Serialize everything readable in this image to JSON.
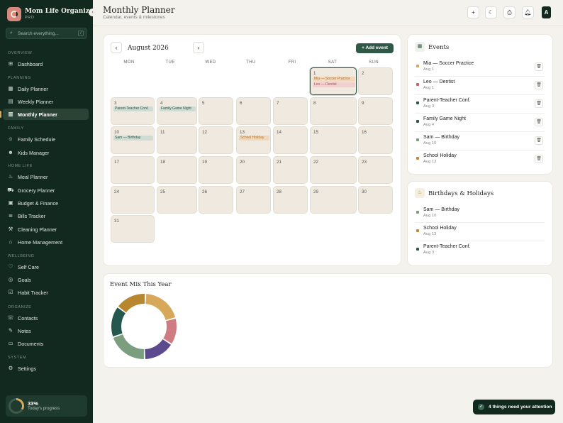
{
  "app": {
    "title": "Mom Life Organizer",
    "plan": "PRO",
    "avatar_initial": "A"
  },
  "search": {
    "placeholder": "Search everything...",
    "shortcut": "/"
  },
  "sidebar": {
    "sections": [
      "OVERVIEW",
      "PLANNING",
      "FAMILY",
      "HOME LIFE",
      "WELLBEING",
      "ORGANIZE",
      "SYSTEM"
    ],
    "items": [
      {
        "label": "Dashboard",
        "icon": "grid-icon"
      },
      {
        "label": "Daily Planner",
        "icon": "calendar-icon"
      },
      {
        "label": "Weekly Planner",
        "icon": "calendar-week-icon"
      },
      {
        "label": "Monthly Planner",
        "icon": "calendar-month-icon"
      },
      {
        "label": "Family Schedule",
        "icon": "people-icon"
      },
      {
        "label": "Kids Manager",
        "icon": "child-icon"
      },
      {
        "label": "Meal Planner",
        "icon": "fork-icon"
      },
      {
        "label": "Grocery Planner",
        "icon": "cart-icon"
      },
      {
        "label": "Budget & Finance",
        "icon": "wallet-icon"
      },
      {
        "label": "Bills Tracker",
        "icon": "receipt-icon"
      },
      {
        "label": "Cleaning Planner",
        "icon": "broom-icon"
      },
      {
        "label": "Home Management",
        "icon": "home-icon"
      },
      {
        "label": "Self Care",
        "icon": "heart-icon"
      },
      {
        "label": "Goals",
        "icon": "target-icon"
      },
      {
        "label": "Habit Tracker",
        "icon": "check-square-icon"
      },
      {
        "label": "Contacts",
        "icon": "contact-icon"
      },
      {
        "label": "Notes",
        "icon": "note-icon"
      },
      {
        "label": "Documents",
        "icon": "document-icon"
      },
      {
        "label": "Settings",
        "icon": "gear-icon"
      }
    ],
    "active_item": "Monthly Planner",
    "progress": {
      "value": "33%",
      "label": "Today's progress",
      "fraction": 0.33
    }
  },
  "header": {
    "title": "Monthly Planner",
    "subtitle": "Calendar, events & milestones"
  },
  "calendar": {
    "month_label": "August 2026",
    "add_label": "Add event",
    "weekdays": [
      "MON",
      "TUE",
      "WED",
      "THU",
      "FRI",
      "SAT",
      "SUN"
    ],
    "days": [
      {
        "n": "1",
        "events": [
          {
            "t": "Mia — Soccer Practice",
            "c": "orange"
          },
          {
            "t": "Leo — Dentist",
            "c": "pink"
          }
        ],
        "today": true
      },
      {
        "n": "2",
        "events": []
      },
      {
        "n": "3",
        "events": [
          {
            "t": "Parent-Teacher Conf.",
            "c": "green"
          }
        ]
      },
      {
        "n": "4",
        "events": [
          {
            "t": "Family Game Night",
            "c": "green"
          }
        ]
      },
      {
        "n": "5",
        "events": []
      },
      {
        "n": "6",
        "events": []
      },
      {
        "n": "7",
        "events": []
      },
      {
        "n": "8",
        "events": []
      },
      {
        "n": "9",
        "events": []
      },
      {
        "n": "10",
        "events": [
          {
            "t": "Sam — Birthday",
            "c": "green"
          }
        ]
      },
      {
        "n": "11",
        "events": []
      },
      {
        "n": "12",
        "events": []
      },
      {
        "n": "13",
        "events": [
          {
            "t": "School Holiday",
            "c": "orange"
          }
        ]
      },
      {
        "n": "14",
        "events": []
      },
      {
        "n": "15",
        "events": []
      },
      {
        "n": "16",
        "events": []
      },
      {
        "n": "17",
        "events": []
      },
      {
        "n": "18",
        "events": []
      },
      {
        "n": "19",
        "events": []
      },
      {
        "n": "20",
        "events": []
      },
      {
        "n": "21",
        "events": []
      },
      {
        "n": "22",
        "events": []
      },
      {
        "n": "23",
        "events": []
      },
      {
        "n": "24",
        "events": []
      },
      {
        "n": "25",
        "events": []
      },
      {
        "n": "26",
        "events": []
      },
      {
        "n": "27",
        "events": []
      },
      {
        "n": "28",
        "events": []
      },
      {
        "n": "29",
        "events": []
      },
      {
        "n": "30",
        "events": []
      },
      {
        "n": "31",
        "events": []
      }
    ]
  },
  "events_panel": {
    "title": "Events",
    "items": [
      {
        "title": "Mia — Soccer Practice",
        "date": "Aug 1",
        "color": "#d7a85a"
      },
      {
        "title": "Leo — Dentist",
        "date": "Aug 1",
        "color": "#c9646b"
      },
      {
        "title": "Parent-Teacher Conf.",
        "date": "Aug 3",
        "color": "#2f5847"
      },
      {
        "title": "Family Game Night",
        "date": "Aug 4",
        "color": "#2f5847"
      },
      {
        "title": "Sam — Birthday",
        "date": "Aug 10",
        "color": "#7a9e7e"
      },
      {
        "title": "School Holiday",
        "date": "Aug 13",
        "color": "#c08a3a"
      }
    ]
  },
  "birthdays_panel": {
    "title": "Birthdays & Holidays",
    "items": [
      {
        "title": "Sam — Birthday",
        "date": "Aug 10",
        "color": "#7a9e7e"
      },
      {
        "title": "School Holiday",
        "date": "Aug 13",
        "color": "#c08a3a"
      },
      {
        "title": "Parent-Teacher Conf.",
        "date": "Aug 3",
        "color": "#2f5847"
      }
    ]
  },
  "chart_data": {
    "type": "pie",
    "title": "Event Mix This Year",
    "values": [
      18,
      12,
      14,
      18,
      14,
      14
    ],
    "colors": [
      "#d7a85a",
      "#cf7b82",
      "#5b4a8e",
      "#7a9e7e",
      "#26574f",
      "#b8862f"
    ]
  },
  "toast": {
    "text": "4 things need your attention"
  }
}
